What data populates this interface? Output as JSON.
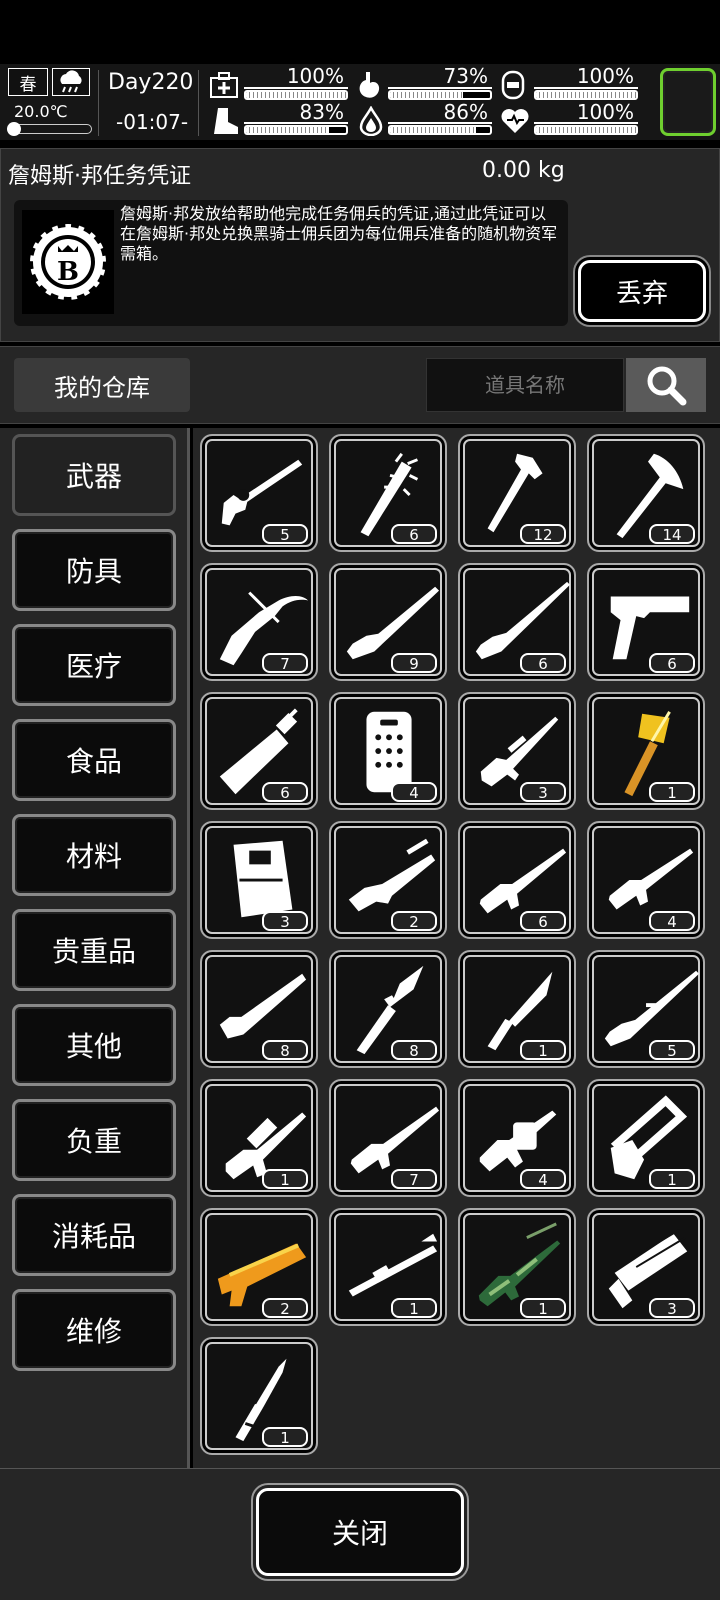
{
  "status": {
    "season": "春",
    "temperature": "20.0℃",
    "day": "Day220",
    "time": "-01:07-",
    "stats": [
      {
        "icon": "medkit-icon",
        "percent": "100%",
        "value": 1.0
      },
      {
        "icon": "stomach-icon",
        "percent": "73%",
        "value": 0.73
      },
      {
        "icon": "bladder-icon",
        "percent": "100%",
        "value": 1.0
      },
      {
        "icon": "boot-icon",
        "percent": "83%",
        "value": 0.83
      },
      {
        "icon": "water-drop-icon",
        "percent": "86%",
        "value": 0.86
      },
      {
        "icon": "heart-icon",
        "percent": "100%",
        "value": 1.0
      }
    ],
    "accent": "#6fcf2f"
  },
  "item": {
    "name": "詹姆斯·邦任务凭证",
    "weight": "0.00 kg",
    "description": "詹姆斯·邦发放给帮助他完成任务佣兵的凭证,通过此凭证可以在詹姆斯·邦处兑换黑骑士佣兵团为每位佣兵准备的随机物资军需箱。",
    "icon_letter": "B",
    "discard_label": "丢弃"
  },
  "warehouse": {
    "label": "我的仓库",
    "search_placeholder": "道具名称"
  },
  "categories": [
    "武器",
    "防具",
    "医疗",
    "食品",
    "材料",
    "贵重品",
    "其他",
    "负重",
    "消耗品",
    "维修"
  ],
  "active_category": "武器",
  "items": [
    {
      "icon": "revolver-icon",
      "count": "5"
    },
    {
      "icon": "spiked-bat-icon",
      "count": "6"
    },
    {
      "icon": "pickaxe-icon",
      "count": "12"
    },
    {
      "icon": "axe-icon",
      "count": "14"
    },
    {
      "icon": "crossbow-icon",
      "count": "7"
    },
    {
      "icon": "bolt-rifle-icon",
      "count": "9"
    },
    {
      "icon": "long-rifle-icon",
      "count": "6"
    },
    {
      "icon": "desert-eagle-icon",
      "count": "6"
    },
    {
      "icon": "great-sword-icon",
      "count": "6"
    },
    {
      "icon": "riot-shield-icon",
      "count": "4"
    },
    {
      "icon": "sniper-rifle-icon",
      "count": "3"
    },
    {
      "icon": "golden-hammer-icon",
      "count": "1"
    },
    {
      "icon": "ammo-box-icon",
      "count": "3"
    },
    {
      "icon": "shotgun-icon",
      "count": "2"
    },
    {
      "icon": "assault-rifle-icon",
      "count": "6"
    },
    {
      "icon": "carbine-icon",
      "count": "4"
    },
    {
      "icon": "sawed-off-icon",
      "count": "8"
    },
    {
      "icon": "spear-icon",
      "count": "8"
    },
    {
      "icon": "combat-knife-icon",
      "count": "1"
    },
    {
      "icon": "mosin-rifle-icon",
      "count": "5"
    },
    {
      "icon": "tactical-rifle-icon",
      "count": "1"
    },
    {
      "icon": "battle-rifle-icon",
      "count": "7"
    },
    {
      "icon": "grenade-launcher-icon",
      "count": "4"
    },
    {
      "icon": "chainsaw-icon",
      "count": "1"
    },
    {
      "icon": "orange-blaster-icon",
      "count": "2"
    },
    {
      "icon": "rocket-launcher-icon",
      "count": "1"
    },
    {
      "icon": "camo-machine-gun-icon",
      "count": "1"
    },
    {
      "icon": "minigun-icon",
      "count": "3"
    },
    {
      "icon": "dagger-icon",
      "count": "1"
    }
  ],
  "footer": {
    "close_label": "关闭"
  }
}
